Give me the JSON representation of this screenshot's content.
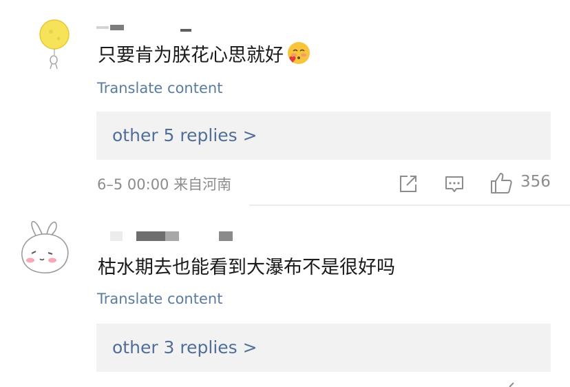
{
  "comments": [
    {
      "username_obscured": true,
      "avatar": "moon-balloon-avatar",
      "text": "只要肯为朕花心思就好",
      "emoji": "blushing-heart-emoji",
      "translate_label": "Translate content",
      "replies_label": "other 5 replies >",
      "meta": "6–5 00:00 来自河南",
      "actions": [
        "share-icon",
        "comment-icon",
        "like-icon"
      ],
      "like_count": "356"
    },
    {
      "username_obscured": true,
      "avatar": "bunny-avatar",
      "text": "枯水期去也能看到大瀑布不是很好吗",
      "translate_label": "Translate content",
      "replies_label": "other 3 replies >"
    }
  ],
  "colors": {
    "link": "#5a7ca0",
    "replies_text": "#506e98",
    "replies_bg": "#f2f2f2",
    "meta": "#8c8c8c"
  }
}
